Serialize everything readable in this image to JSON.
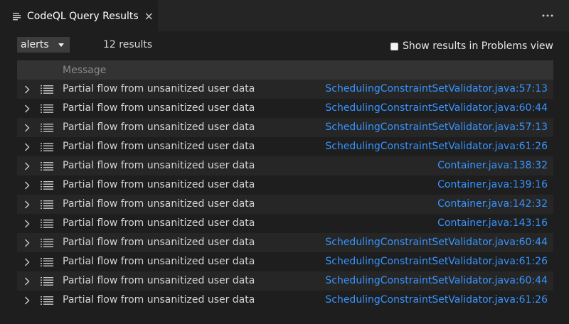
{
  "tab": {
    "title": "CodeQL Query Results",
    "close_label": "×"
  },
  "toolbar": {
    "select_value": "alerts",
    "result_count": "12 results",
    "problems_label": "Show results in Problems view"
  },
  "table": {
    "header": "Message",
    "rows": [
      {
        "message": "Partial flow from unsanitized user data",
        "location": "SchedulingConstraintSetValidator.java:57:13"
      },
      {
        "message": "Partial flow from unsanitized user data",
        "location": "SchedulingConstraintSetValidator.java:60:44"
      },
      {
        "message": "Partial flow from unsanitized user data",
        "location": "SchedulingConstraintSetValidator.java:57:13"
      },
      {
        "message": "Partial flow from unsanitized user data",
        "location": "SchedulingConstraintSetValidator.java:61:26"
      },
      {
        "message": "Partial flow from unsanitized user data",
        "location": "Container.java:138:32"
      },
      {
        "message": "Partial flow from unsanitized user data",
        "location": "Container.java:139:16"
      },
      {
        "message": "Partial flow from unsanitized user data",
        "location": "Container.java:142:32"
      },
      {
        "message": "Partial flow from unsanitized user data",
        "location": "Container.java:143:16"
      },
      {
        "message": "Partial flow from unsanitized user data",
        "location": "SchedulingConstraintSetValidator.java:60:44"
      },
      {
        "message": "Partial flow from unsanitized user data",
        "location": "SchedulingConstraintSetValidator.java:61:26"
      },
      {
        "message": "Partial flow from unsanitized user data",
        "location": "SchedulingConstraintSetValidator.java:60:44"
      },
      {
        "message": "Partial flow from unsanitized user data",
        "location": "SchedulingConstraintSetValidator.java:61:26"
      }
    ]
  },
  "icons": {
    "tab": "list-flat-icon",
    "more": "ellipsis-icon",
    "caret": "caret-down-icon",
    "expander": "chevron-right-icon",
    "row": "list-flat-icon"
  },
  "colors": {
    "link": "#3794ff",
    "background": "#1e1e1e",
    "tabbar": "#252526"
  }
}
